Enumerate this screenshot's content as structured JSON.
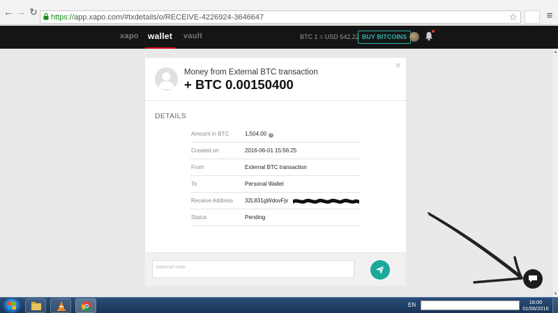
{
  "browser": {
    "url_scheme": "https://",
    "url_rest": "app.xapo.com/#txdetails/o/RECEIVE-4226924-3646647",
    "back_icon": "arrow-left-icon",
    "forward_icon": "arrow-right-icon",
    "reload_icon": "reload-icon",
    "star_icon": "star-icon",
    "menu_icon": "hamburger-menu-icon"
  },
  "header": {
    "tabs": [
      {
        "label": "xapo",
        "active": false
      },
      {
        "label": "wallet",
        "active": true
      },
      {
        "label": "vault",
        "active": false
      }
    ],
    "rate": "BTC 1 = USD 542.22",
    "buy_label": "BUY BITCOINS",
    "accent_color": "#2ab3a6",
    "active_tab_color": "#d0021b"
  },
  "transaction": {
    "title": "Money from External BTC transaction",
    "amount": "+ BTC 0.00150400",
    "details_heading": "DETAILS",
    "rows": [
      {
        "label": "Amount in BTC",
        "value": "1,504.00"
      },
      {
        "label": "Created on",
        "value": "2016-06-01 15:56:25"
      },
      {
        "label": "From",
        "value": "External BTC transaction"
      },
      {
        "label": "To",
        "value": "Personal Wallet"
      },
      {
        "label": "Receive Address",
        "value": "32L831gWdovFjx"
      },
      {
        "label": "Status",
        "value": "Pending"
      }
    ],
    "note_placeholder": "Internal note",
    "send_color": "#1ba99a"
  },
  "taskbar": {
    "lang": "EN",
    "time": "18:00",
    "date": "01/06/2016"
  }
}
